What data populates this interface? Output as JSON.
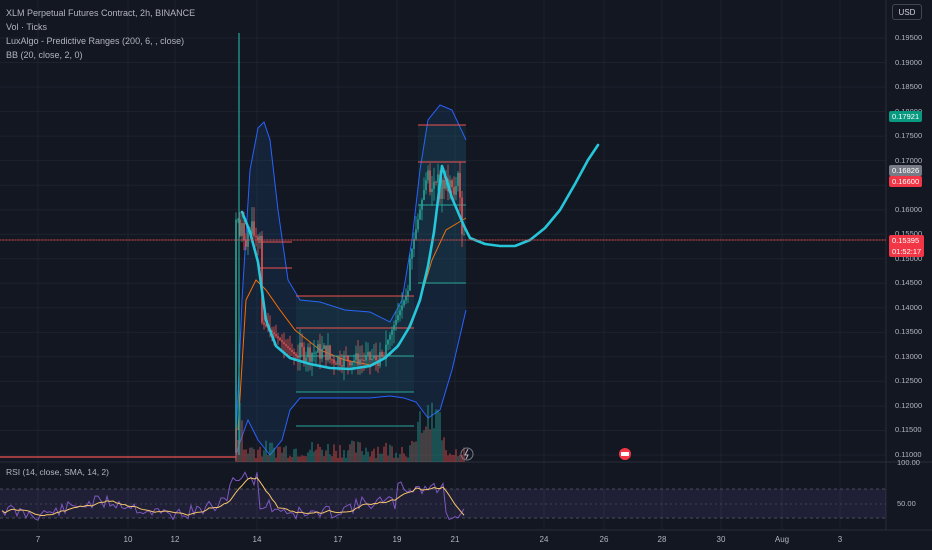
{
  "legend": {
    "symbol": "XLM Perpetual Futures Contract, 2h, BINANCE",
    "volume": "Vol · Ticks",
    "indicator1": "LuxAlgo - Predictive Ranges (200, 6, , close)",
    "indicator2": "BB (20, close, 2, 0)"
  },
  "currency": "USD",
  "rsi_label": "RSI (14, close, SMA, 14, 2)",
  "price_axis": [
    "0.19500",
    "0.19000",
    "0.18500",
    "0.18000",
    "0.17500",
    "0.17000",
    "0.16500",
    "0.16000",
    "0.15500",
    "0.15000",
    "0.14500",
    "0.14000",
    "0.13500",
    "0.13000",
    "0.12500",
    "0.12000",
    "0.11500",
    "0.11000"
  ],
  "price_labels": {
    "upper_level": "0.17921",
    "level_mid": "0.16826",
    "level_low": "0.16600",
    "last_price": "0.15395",
    "countdown": "01:52:17"
  },
  "rsi_axis": {
    "top": "100.00",
    "mid": "50.00"
  },
  "date_axis": [
    "7",
    "10",
    "12",
    "14",
    "17",
    "19",
    "21",
    "24",
    "26",
    "28",
    "30",
    "Aug",
    "3"
  ],
  "colors": {
    "background": "#131722",
    "up": "#26a69a",
    "down": "#ef5350",
    "cyan_line": "#26c6da",
    "bb_band": "#2962ff",
    "rsi_line": "#7e57c2",
    "rsi_ma": "#f7c56b",
    "upper_level_label": "#089981",
    "level_mid_label": "#787b86",
    "level_low_label": "#f23645"
  },
  "chart_data": {
    "type": "line",
    "note_series": [
      {
        "name": "Predictive path",
        "values": [
          0.159,
          0.1545,
          0.151,
          0.147,
          0.144,
          0.1405,
          0.1375,
          0.1345,
          0.132,
          0.1305,
          0.13,
          0.1295,
          0.1298,
          0.1302,
          0.131,
          0.132,
          0.1345,
          0.139,
          0.147,
          0.156,
          0.162,
          0.17,
          0.166,
          0.161,
          0.157,
          0.1545,
          0.153,
          0.1525,
          0.1525,
          0.154,
          0.158,
          0.164,
          0.171,
          0.1735
        ]
      }
    ],
    "ylim": [
      0.11,
      0.196
    ],
    "grid": true
  }
}
